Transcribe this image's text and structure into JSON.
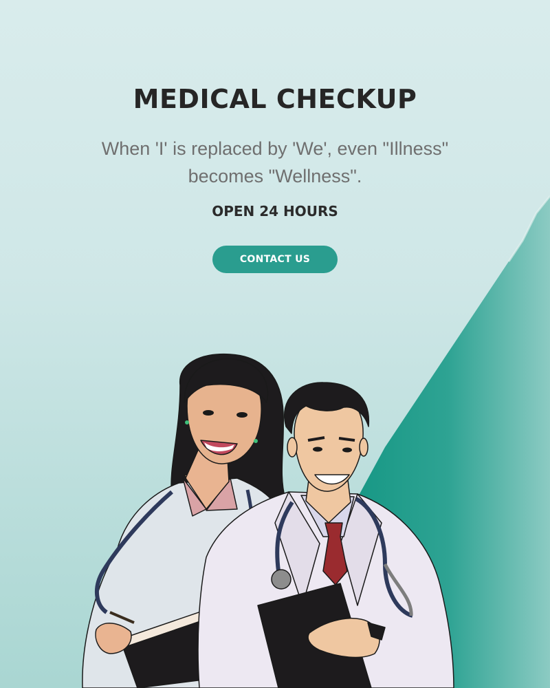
{
  "hero": {
    "headline": "MEDICAL CHECKUP",
    "quote": "When 'I' is replaced by 'We', even \"Illness\" becomes \"Wellness\".",
    "hours": "OPEN 24 HOURS",
    "cta_label": "CONTACT US"
  },
  "colors": {
    "accent": "#2a9d8f",
    "background": "#d3e9e9",
    "headline": "#262626",
    "quote": "#6f6f6f"
  },
  "illustration": {
    "subjects": [
      "female-doctor",
      "male-doctor"
    ]
  }
}
